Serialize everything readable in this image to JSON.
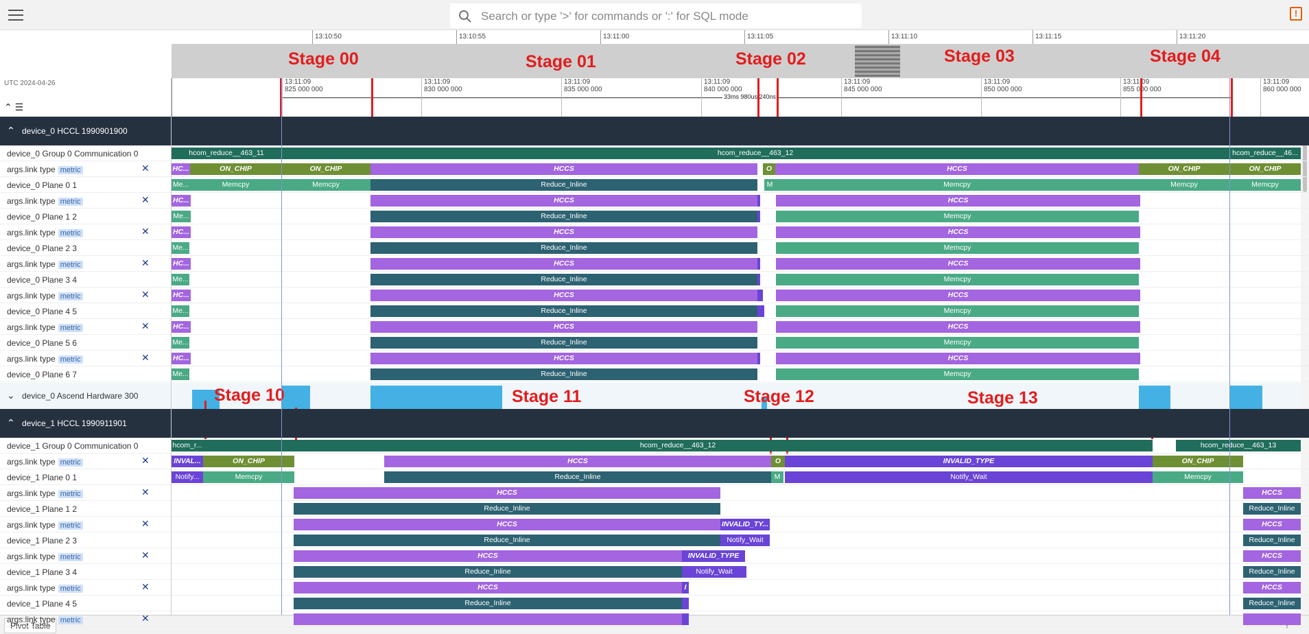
{
  "search": {
    "placeholder": "Search or type '>' for commands or ':' for SQL mode"
  },
  "overview_ticks": [
    "13:10:50",
    "13:10:55",
    "13:11:00",
    "13:11:05",
    "13:11:10",
    "13:11:15",
    "13:11:20"
  ],
  "utc_label": "UTC 2024-04-26",
  "time_ticks": [
    {
      "t": "13:11:09",
      "v": "825 000 000"
    },
    {
      "t": "13:11:09",
      "v": "830 000 000"
    },
    {
      "t": "13:11:09",
      "v": "835 000 000"
    },
    {
      "t": "13:11:09",
      "v": "840 000 000"
    },
    {
      "t": "13:11:09",
      "v": "845 000 000"
    },
    {
      "t": "13:11:09",
      "v": "850 000 000"
    },
    {
      "t": "13:11:09",
      "v": "855 000 000"
    },
    {
      "t": "13:11:09",
      "v": "860 000 000"
    }
  ],
  "span_label": "33ms 980us 240ns",
  "groups": [
    {
      "title": "device_0 HCCL 1990901900"
    },
    {
      "title": "device_1 HCCL 1990911901"
    }
  ],
  "hw_row": {
    "title": "device_0 Ascend Hardware 300"
  },
  "metric_badge": "metric",
  "close_glyph": "✕",
  "stages": [
    "Stage 00",
    "Stage 01",
    "Stage 02",
    "Stage 03",
    "Stage 04",
    "Stage 10",
    "Stage 11",
    "Stage 12",
    "Stage 13"
  ],
  "colors": {
    "HCCS": "#a365e0",
    "ON_CHIP": "#6f8f34",
    "Memcpy": "#4aaa85",
    "Reduce_Inline": "#2d6272",
    "Comm": "#1f6d5a",
    "INVALID_TYPE": "#6a44d6",
    "Notify_Wait": "#6a44d6",
    "Hardware": "#43b1e4",
    "Header": "#263140",
    "Stage": "#e21d1d"
  },
  "tracks0": [
    {
      "label": "device_0 Group 0 Communication 0",
      "metric": false,
      "slices": [
        [
          "hcom_reduce__463_11",
          "Comm",
          250,
          410,
          0
        ],
        [
          "hcom_reduce__463_12",
          "Comm",
          410,
          1792,
          0
        ],
        [
          "hcom_reduce__46...",
          "Comm",
          1792,
          1896,
          0
        ]
      ]
    },
    {
      "label": "args.link type",
      "metric": true,
      "slices": [
        [
          "HC...",
          "HCCS",
          250,
          277,
          1
        ],
        [
          "ON_CHIP",
          "ON_CHIP",
          277,
          410,
          1
        ],
        [
          "ON_CHIP",
          "ON_CHIP",
          410,
          540,
          1
        ],
        [
          "HCCS",
          "HCCS",
          540,
          1104,
          1
        ],
        [
          "O",
          "ON_CHIP",
          1112,
          1130,
          1
        ],
        [
          "HCCS",
          "HCCS",
          1130,
          1660,
          1
        ],
        [
          "ON_CHIP",
          "ON_CHIP",
          1660,
          1792,
          1
        ],
        [
          "ON_CHIP",
          "ON_CHIP",
          1792,
          1896,
          1
        ]
      ]
    },
    {
      "label": "device_0 Plane 0 1",
      "metric": false,
      "slices": [
        [
          "Me...",
          "Memcpy",
          250,
          277,
          0
        ],
        [
          "Memcpy",
          "Memcpy",
          277,
          410,
          0
        ],
        [
          "Memcpy",
          "Memcpy",
          410,
          540,
          0
        ],
        [
          "Reduce_Inline",
          "Reduce_Inline",
          540,
          1104,
          0
        ],
        [
          "M",
          "Memcpy",
          1114,
          1130,
          0
        ],
        [
          "Memcpy",
          "Memcpy",
          1130,
          1660,
          0
        ],
        [
          "Memcpy",
          "Memcpy",
          1660,
          1792,
          0
        ],
        [
          "Memcpy",
          "Memcpy",
          1792,
          1896,
          0
        ]
      ]
    },
    {
      "label": "args.link type",
      "metric": true,
      "slices": [
        [
          "HC...",
          "HCCS",
          250,
          278,
          1
        ],
        [
          "HCCS",
          "HCCS",
          540,
          1104,
          1
        ],
        [
          "",
          "INVALID_TYPE",
          1104,
          1108,
          0
        ],
        [
          "HCCS",
          "HCCS",
          1131,
          1662,
          1
        ]
      ]
    },
    {
      "label": "device_0 Plane 1 2",
      "metric": false,
      "slices": [
        [
          "Me...",
          "Memcpy",
          250,
          278,
          0
        ],
        [
          "Reduce_Inline",
          "Reduce_Inline",
          540,
          1104,
          0
        ],
        [
          "",
          "INVALID_TYPE",
          1104,
          1108,
          0
        ],
        [
          "Memcpy",
          "Memcpy",
          1131,
          1660,
          0
        ]
      ]
    },
    {
      "label": "args.link type",
      "metric": true,
      "slices": [
        [
          "HC...",
          "HCCS",
          250,
          278,
          1
        ],
        [
          "HCCS",
          "HCCS",
          540,
          1104,
          1
        ],
        [
          "HCCS",
          "HCCS",
          1131,
          1662,
          1
        ]
      ]
    },
    {
      "label": "device_0 Plane 2 3",
      "metric": false,
      "slices": [
        [
          "Me...",
          "Memcpy",
          250,
          276,
          0
        ],
        [
          "Reduce_Inline",
          "Reduce_Inline",
          540,
          1104,
          0
        ],
        [
          "Memcpy",
          "Memcpy",
          1131,
          1660,
          0
        ]
      ]
    },
    {
      "label": "args.link type",
      "metric": true,
      "slices": [
        [
          "HC...",
          "HCCS",
          250,
          278,
          1
        ],
        [
          "HCCS",
          "HCCS",
          540,
          1104,
          1
        ],
        [
          "",
          "INVALID_TYPE",
          1104,
          1108,
          0
        ],
        [
          "HCCS",
          "HCCS",
          1131,
          1662,
          1
        ]
      ]
    },
    {
      "label": "device_0 Plane 3 4",
      "metric": false,
      "slices": [
        [
          "Me...",
          "Memcpy",
          250,
          276,
          0
        ],
        [
          "Reduce_Inline",
          "Reduce_Inline",
          540,
          1104,
          0
        ],
        [
          "",
          "INVALID_TYPE",
          1104,
          1108,
          0
        ],
        [
          "Memcpy",
          "Memcpy",
          1131,
          1660,
          0
        ]
      ]
    },
    {
      "label": "args.link type",
      "metric": true,
      "slices": [
        [
          "HC...",
          "HCCS",
          250,
          278,
          1
        ],
        [
          "HCCS",
          "HCCS",
          540,
          1104,
          1
        ],
        [
          "",
          "INVALID_TYPE",
          1104,
          1112,
          0
        ],
        [
          "HCCS",
          "HCCS",
          1131,
          1662,
          1
        ]
      ]
    },
    {
      "label": "device_0 Plane 4 5",
      "metric": false,
      "slices": [
        [
          "Me...",
          "Memcpy",
          250,
          276,
          0
        ],
        [
          "Reduce_Inline",
          "Reduce_Inline",
          540,
          1104,
          0
        ],
        [
          "",
          "INVALID_TYPE",
          1104,
          1114,
          0
        ],
        [
          "Memcpy",
          "Memcpy",
          1131,
          1660,
          0
        ]
      ]
    },
    {
      "label": "args.link type",
      "metric": true,
      "slices": [
        [
          "HC...",
          "HCCS",
          250,
          278,
          1
        ],
        [
          "HCCS",
          "HCCS",
          540,
          1104,
          1
        ],
        [
          "HCCS",
          "HCCS",
          1131,
          1662,
          1
        ]
      ]
    },
    {
      "label": "device_0 Plane 5 6",
      "metric": false,
      "slices": [
        [
          "Me...",
          "Memcpy",
          250,
          276,
          0
        ],
        [
          "Reduce_Inline",
          "Reduce_Inline",
          540,
          1104,
          0
        ],
        [
          "Memcpy",
          "Memcpy",
          1131,
          1660,
          0
        ]
      ]
    },
    {
      "label": "args.link type",
      "metric": true,
      "slices": [
        [
          "HC...",
          "HCCS",
          250,
          278,
          1
        ],
        [
          "HCCS",
          "HCCS",
          540,
          1104,
          1
        ],
        [
          "",
          "INVALID_TYPE",
          1104,
          1108,
          0
        ],
        [
          "HCCS",
          "HCCS",
          1131,
          1662,
          1
        ]
      ]
    },
    {
      "label": "device_0 Plane 6 7",
      "metric": false,
      "slices": [
        [
          "Me...",
          "Memcpy",
          250,
          276,
          0
        ],
        [
          "Reduce_Inline",
          "Reduce_Inline",
          540,
          1104,
          0
        ],
        [
          "Memcpy",
          "Memcpy",
          1131,
          1660,
          0
        ]
      ]
    }
  ],
  "tracks1": [
    {
      "label": "device_1 Group 0 Communication 0",
      "metric": false,
      "slices": [
        [
          "hcom_r...",
          "Comm",
          250,
          296,
          0
        ],
        [
          "hcom_reduce__463_12",
          "Comm",
          296,
          1680,
          0
        ],
        [
          "hcom_reduce__463_13",
          "Comm",
          1714,
          1896,
          0
        ]
      ]
    },
    {
      "label": "args.link type",
      "metric": true,
      "slices": [
        [
          "INVAL...",
          "INVALID_TYPE",
          250,
          296,
          1
        ],
        [
          "ON_CHIP",
          "ON_CHIP",
          296,
          429,
          1
        ],
        [
          "HCCS",
          "HCCS",
          560,
          1124,
          1
        ],
        [
          "O",
          "ON_CHIP",
          1124,
          1144,
          1
        ],
        [
          "INVALID_TYPE",
          "INVALID_TYPE",
          1144,
          1680,
          1
        ],
        [
          "ON_CHIP",
          "ON_CHIP",
          1680,
          1812,
          1
        ]
      ]
    },
    {
      "label": "device_1 Plane 0 1",
      "metric": false,
      "slices": [
        [
          "Notify...",
          "INVALID_TYPE",
          250,
          296,
          0
        ],
        [
          "Memcpy",
          "Memcpy",
          296,
          429,
          0
        ],
        [
          "Reduce_Inline",
          "Reduce_Inline",
          560,
          1124,
          0
        ],
        [
          "M",
          "Memcpy",
          1124,
          1142,
          0
        ],
        [
          "Notify_Wait",
          "INVALID_TYPE",
          1144,
          1680,
          0
        ],
        [
          "Memcpy",
          "Memcpy",
          1680,
          1812,
          0
        ]
      ]
    },
    {
      "label": "args.link type",
      "metric": true,
      "slices": [
        [
          "HCCS",
          "HCCS",
          428,
          1050,
          1
        ],
        [
          "HCCS",
          "HCCS",
          1812,
          1896,
          1
        ]
      ]
    },
    {
      "label": "device_1 Plane 1 2",
      "metric": false,
      "slices": [
        [
          "Reduce_Inline",
          "Reduce_Inline",
          428,
          1050,
          0
        ],
        [
          "Reduce_Inline",
          "Reduce_Inline",
          1812,
          1896,
          0
        ]
      ]
    },
    {
      "label": "args.link type",
      "metric": true,
      "slices": [
        [
          "HCCS",
          "HCCS",
          428,
          1050,
          1
        ],
        [
          "INVALID_TY...",
          "INVALID_TYPE",
          1050,
          1122,
          1
        ],
        [
          "HCCS",
          "HCCS",
          1812,
          1896,
          1
        ]
      ]
    },
    {
      "label": "device_1 Plane 2 3",
      "metric": false,
      "slices": [
        [
          "Reduce_Inline",
          "Reduce_Inline",
          428,
          1050,
          0
        ],
        [
          "Notify_Wait",
          "INVALID_TYPE",
          1050,
          1122,
          0
        ],
        [
          "Reduce_Inline",
          "Reduce_Inline",
          1812,
          1896,
          0
        ]
      ]
    },
    {
      "label": "args.link type",
      "metric": true,
      "slices": [
        [
          "HCCS",
          "HCCS",
          428,
          994,
          1
        ],
        [
          "INVALID_TYPE",
          "INVALID_TYPE",
          994,
          1086,
          1
        ],
        [
          "HCCS",
          "HCCS",
          1812,
          1896,
          1
        ]
      ]
    },
    {
      "label": "device_1 Plane 3 4",
      "metric": false,
      "slices": [
        [
          "Reduce_Inline",
          "Reduce_Inline",
          428,
          994,
          0
        ],
        [
          "Notify_Wait",
          "INVALID_TYPE",
          994,
          1088,
          0
        ],
        [
          "Reduce_Inline",
          "Reduce_Inline",
          1812,
          1896,
          0
        ]
      ]
    },
    {
      "label": "args.link type",
      "metric": true,
      "slices": [
        [
          "HCCS",
          "HCCS",
          428,
          994,
          1
        ],
        [
          "I",
          "INVALID_TYPE",
          994,
          1004,
          1
        ],
        [
          "HCCS",
          "HCCS",
          1812,
          1896,
          1
        ]
      ]
    },
    {
      "label": "device_1 Plane 4 5",
      "metric": false,
      "slices": [
        [
          "Reduce_Inline",
          "Reduce_Inline",
          428,
          994,
          0
        ],
        [
          "",
          "INVALID_TYPE",
          994,
          1004,
          0
        ],
        [
          "Reduce_Inline",
          "Reduce_Inline",
          1812,
          1896,
          0
        ]
      ]
    },
    {
      "label": "args.link type",
      "metric": true,
      "slices": [
        [
          "",
          "HCCS",
          428,
          994,
          0
        ],
        [
          "",
          "INVALID_TYPE",
          994,
          1004,
          0
        ],
        [
          "",
          "HCCS",
          1812,
          1896,
          0
        ]
      ]
    }
  ],
  "bottom": {
    "pivot_tab": "Pivot Table"
  }
}
